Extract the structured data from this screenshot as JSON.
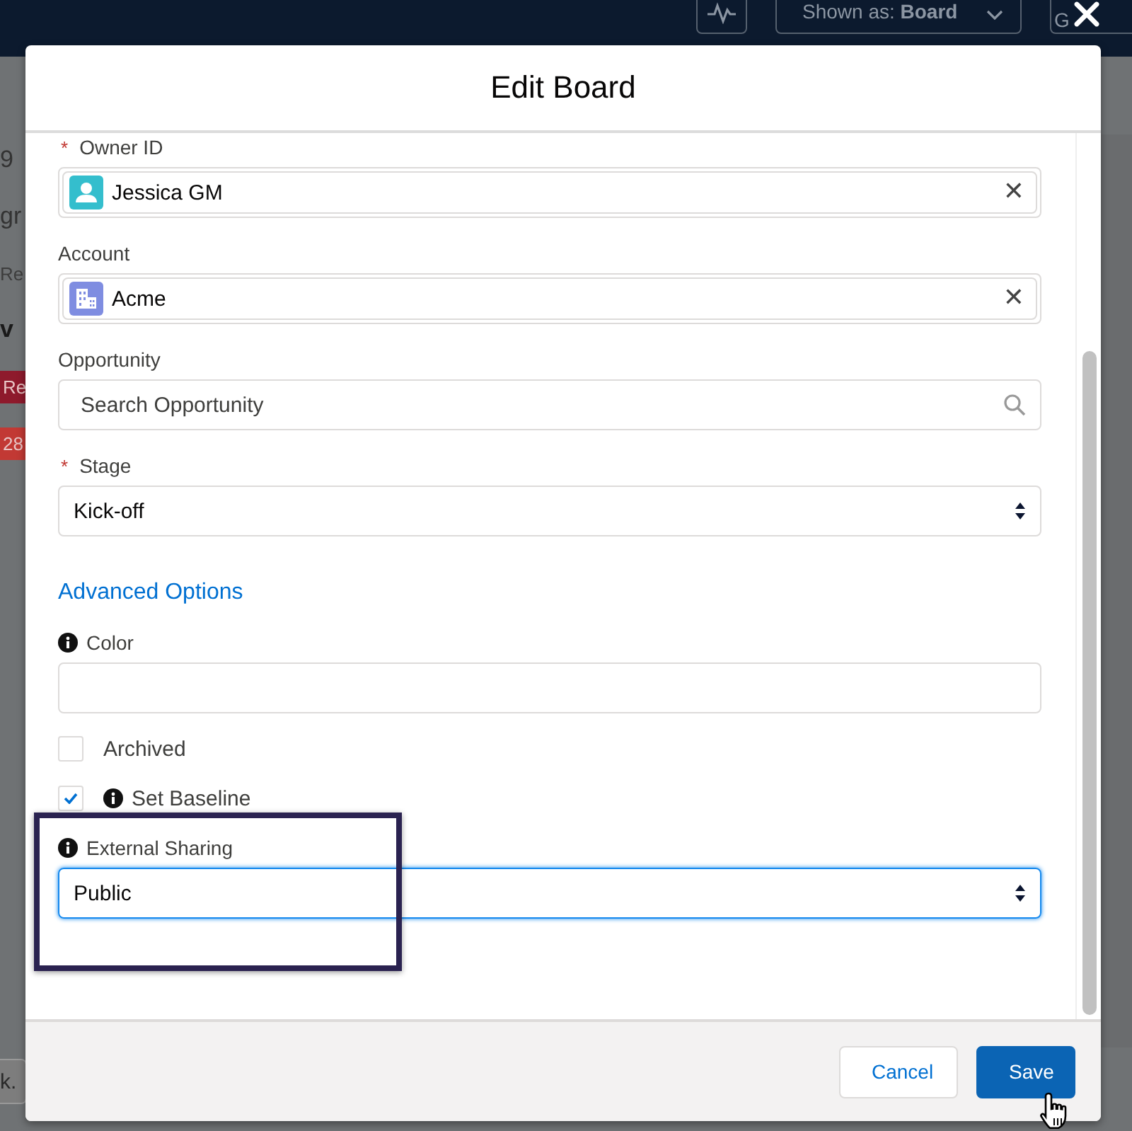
{
  "backdrop": {
    "toolbar": {
      "shown_as": "Shown as: **Board**",
      "group_button": "G"
    },
    "left_column": [
      {
        "kind": "text",
        "text": "9"
      },
      {
        "kind": "text",
        "text": "gr"
      },
      {
        "kind": "muted",
        "text": "Re"
      },
      {
        "kind": "bold",
        "text": "v"
      },
      {
        "kind": "badge",
        "text": "Re",
        "color": "#8e1a2c"
      },
      {
        "kind": "badge",
        "text": "28",
        "color": "#c23934"
      }
    ],
    "search_stub": "k."
  },
  "modal": {
    "title": "Edit Board",
    "fields": [
      {
        "kind": "lookup",
        "label": "Owner ID",
        "required_mark": "*",
        "info": false,
        "value": "Jessica GM",
        "clear": "✕"
      },
      {
        "kind": "lookup",
        "label": "Account",
        "info": false,
        "value": "Acme",
        "clear": "✕"
      },
      {
        "kind": "search",
        "label": "Opportunity",
        "info": false,
        "placeholder": "Search Opportunity"
      },
      {
        "kind": "select",
        "label": "Stage",
        "required_mark": "*",
        "info": false,
        "value": "Kick-off",
        "focused": false
      },
      {
        "kind": "section",
        "text": "Advanced Options"
      },
      {
        "kind": "text",
        "label": "Color",
        "info": true
      },
      {
        "kind": "checkbox",
        "label": "Archived",
        "info": false,
        "checked": false
      },
      {
        "kind": "checkbox",
        "label": "Set Baseline",
        "info": true,
        "checked": true
      },
      {
        "kind": "select",
        "label": "External Sharing",
        "info": true,
        "value": "Public",
        "focused": true
      }
    ],
    "buttons": [
      {
        "kind": "neutral",
        "label": "Cancel"
      },
      {
        "kind": "brand",
        "label": "Save"
      }
    ]
  }
}
